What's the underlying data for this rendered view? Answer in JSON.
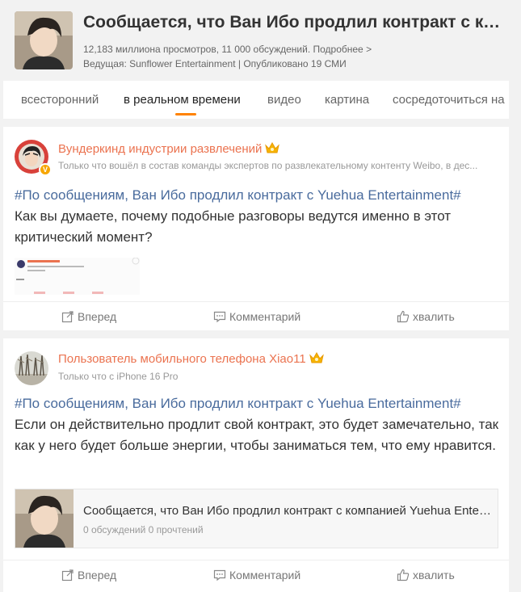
{
  "topic": {
    "title": "Сообщается, что Ван Ибо продлил контракт с компанией Yuehua Entertainment",
    "stats": "12,183 миллиона просмотров, 11 000 обсуждений. Подробнее >",
    "host": "Ведущая: Sunflower Entertainment | Опубликовано 19 СМИ"
  },
  "tabs": [
    {
      "label": "всесторонний"
    },
    {
      "label": "в реальном времени"
    },
    {
      "label": "видео"
    },
    {
      "label": "картина"
    },
    {
      "label": "сосредоточиться на"
    }
  ],
  "posts": [
    {
      "user": "Вундеркинд индустрии развлечений",
      "meta": "Только что вошёл в состав команды экспертов по развлекательному контенту Weibo, в дес...",
      "hashtag": "#По сообщениям, Ван Ибо продлил контракт с Yuehua Entertainment#",
      "text": "Как вы думаете, почему подобные разговоры ведутся именно в этот критический момент?",
      "actions": {
        "forward": "Вперед",
        "comment": "Комментарий",
        "like": "хвалить"
      }
    },
    {
      "user": "Пользователь мобильного телефона Xiao11",
      "meta": "Только что с iPhone 16 Pro",
      "hashtag": "#По сообщениям, Ван Ибо продлил контракт с Yuehua Entertainment#",
      "text": "Если он действительно продлит свой контракт, это будет замечательно, так как у него будет больше энергии, чтобы заниматься тем, что ему нравится.",
      "share": {
        "title": "Сообщается, что Ван Ибо продлил контракт с компанией Yuehua Entertainment",
        "meta": "0 обсуждений 0 прочтений"
      },
      "actions": {
        "forward": "Вперед",
        "comment": "Комментарий",
        "like": "хвалить"
      }
    }
  ],
  "colors": {
    "accent": "#ff8200",
    "username": "#eb7350",
    "hashtag": "#496b9d"
  }
}
